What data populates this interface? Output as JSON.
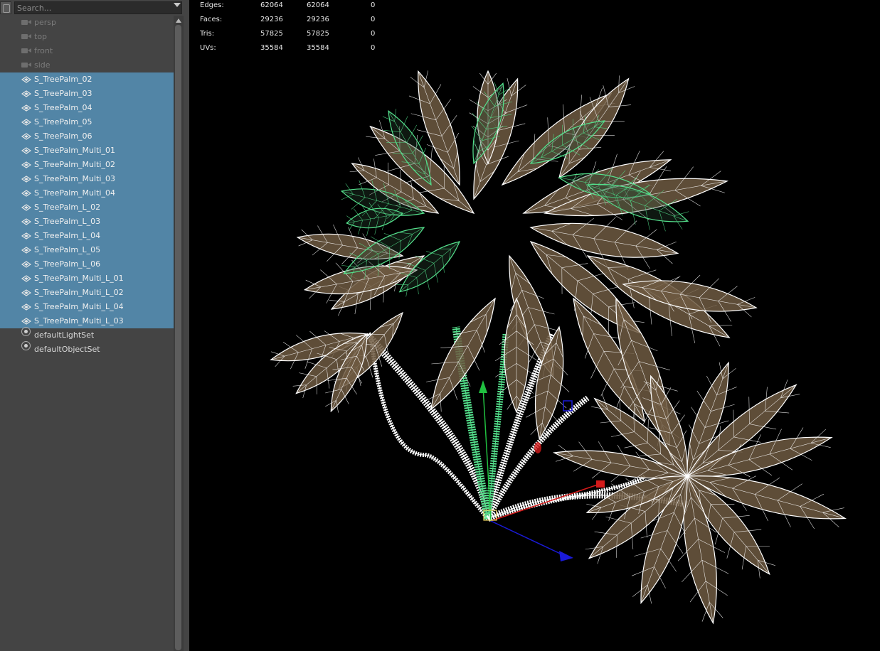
{
  "outliner": {
    "search_placeholder": "Search...",
    "cameras": [
      "persp",
      "top",
      "front",
      "side"
    ],
    "selected_objects": [
      "S_TreePalm_02",
      "S_TreePalm_03",
      "S_TreePalm_04",
      "S_TreePalm_05",
      "S_TreePalm_06",
      "S_TreePalm_Multi_01",
      "S_TreePalm_Multi_02",
      "S_TreePalm_Multi_03",
      "S_TreePalm_Multi_04",
      "S_TreePalm_L_02",
      "S_TreePalm_L_03",
      "S_TreePalm_L_04",
      "S_TreePalm_L_05",
      "S_TreePalm_L_06",
      "S_TreePalm_Multi_L_01",
      "S_TreePalm_Multi_L_02",
      "S_TreePalm_Multi_L_04",
      "S_TreePalm_Multi_L_03"
    ],
    "sets": [
      "defaultLightSet",
      "defaultObjectSet"
    ],
    "selection_color": "#5285a6"
  },
  "hud": {
    "rows": [
      {
        "label": "Edges:",
        "a": "62064",
        "b": "62064",
        "c": "0"
      },
      {
        "label": "Faces:",
        "a": "29236",
        "b": "29236",
        "c": "0"
      },
      {
        "label": "Tris:",
        "a": "57825",
        "b": "57825",
        "c": "0"
      },
      {
        "label": "UVs:",
        "a": "35584",
        "b": "35584",
        "c": "0"
      }
    ]
  },
  "viewport": {
    "wireframe_color": "#ffffff",
    "selected_wire_color": "#54e08c",
    "leaf_fill_color": "#6e5a42",
    "manipulator": {
      "x_axis": "#d41a1a",
      "y_axis": "#20c040",
      "z_axis": "#1a1ad8"
    }
  }
}
